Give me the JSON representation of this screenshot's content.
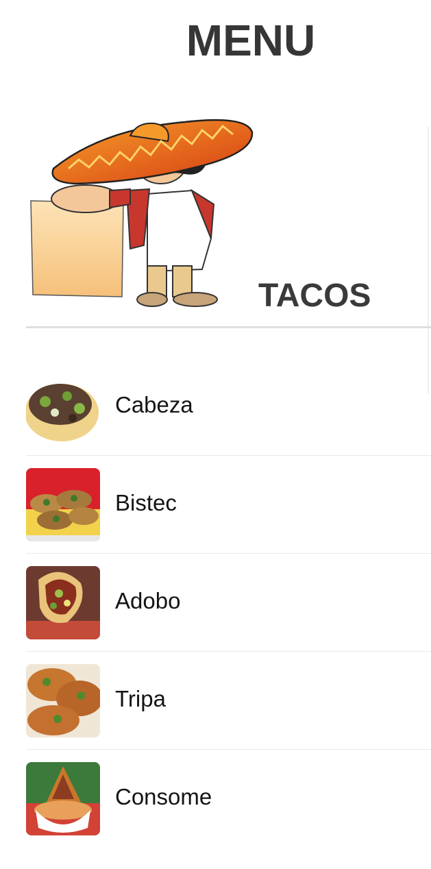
{
  "page": {
    "title": "MENU"
  },
  "section": {
    "title": "TACOS"
  },
  "mascot": {
    "icon": "mascot-chef-sombrero-illustration"
  },
  "items": [
    {
      "label": "Cabeza",
      "image": "taco-cabeza-photo"
    },
    {
      "label": "Bistec",
      "image": "taco-bistec-photo"
    },
    {
      "label": "Adobo",
      "image": "taco-adobo-photo"
    },
    {
      "label": "Tripa",
      "image": "taco-tripa-photo"
    },
    {
      "label": "Consome",
      "image": "taco-consome-photo"
    }
  ],
  "colors": {
    "title": "#363636",
    "divider": "#dedede",
    "sombrero": "#e8501a",
    "tortilla": "#f1d59a"
  }
}
